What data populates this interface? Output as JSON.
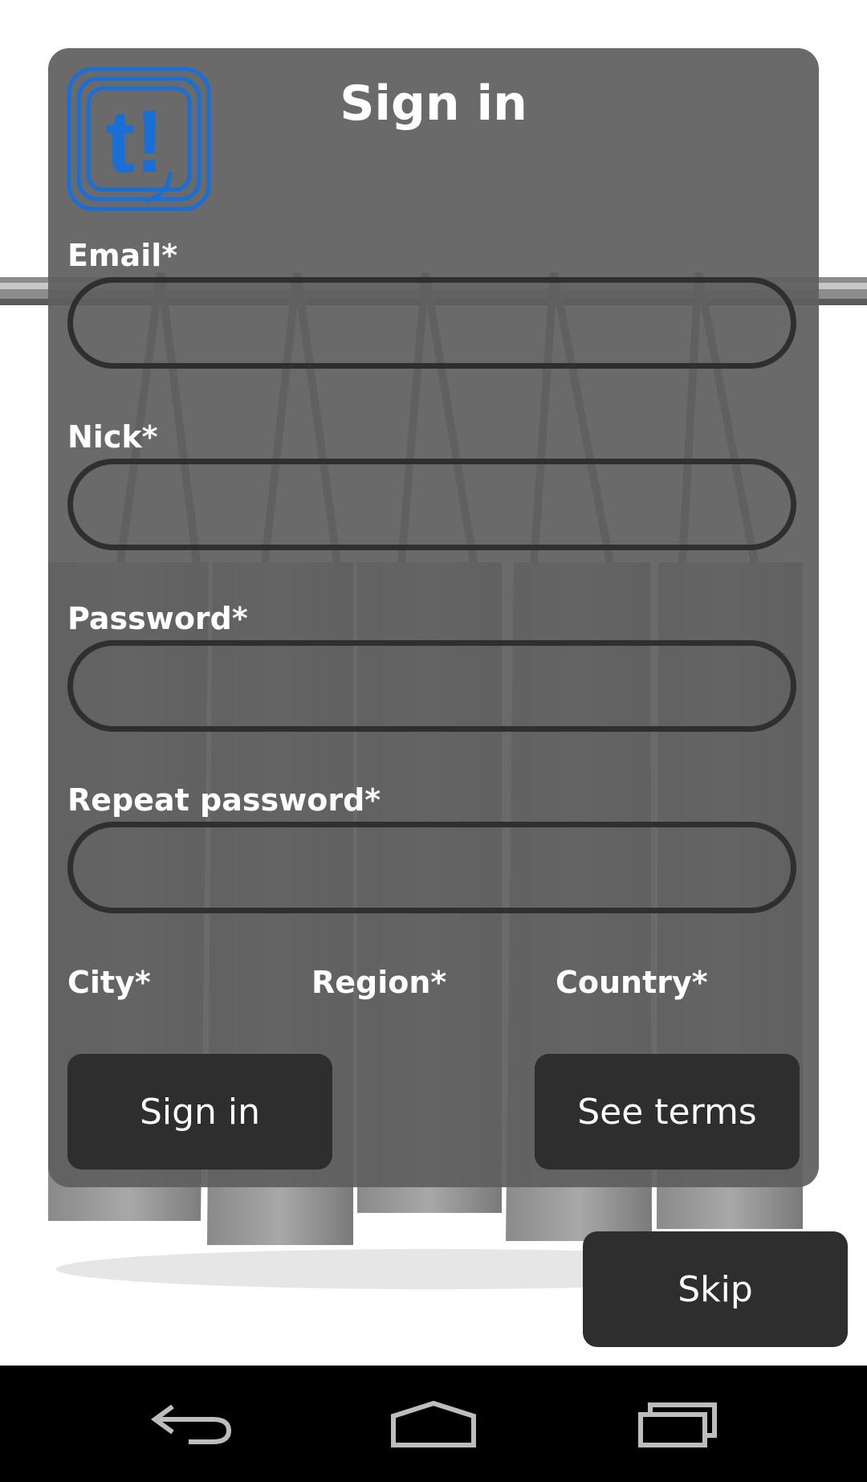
{
  "header": {
    "title": "Sign in",
    "logo_text": "t!"
  },
  "form": {
    "email_label": "Email*",
    "email_value": "",
    "nick_label": "Nick*",
    "nick_value": "",
    "password_label": "Password*",
    "password_value": "",
    "repeat_password_label": "Repeat password*",
    "repeat_password_value": "",
    "city_label": "City*",
    "region_label": "Region*",
    "country_label": "Country*"
  },
  "buttons": {
    "sign_in": "Sign in",
    "see_terms": "See terms",
    "skip": "Skip"
  },
  "navbar": {
    "back_icon": "back-icon",
    "home_icon": "home-icon",
    "recents_icon": "recents-icon"
  },
  "colors": {
    "panel": "#5f5f5f",
    "button": "#2e2e2e",
    "logo_blue": "#1a6fd6",
    "field_border": "#2f2f2f"
  }
}
